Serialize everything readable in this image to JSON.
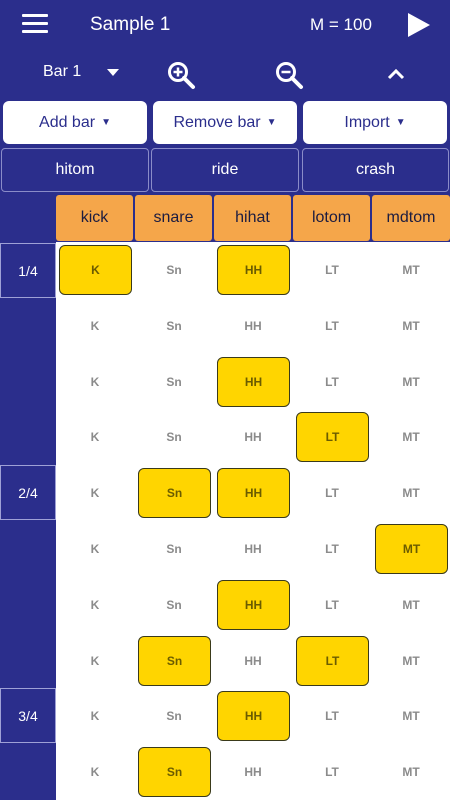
{
  "header": {
    "title": "Sample 1",
    "tempo": "M = 100"
  },
  "toolbar": {
    "bar_label": "Bar 1"
  },
  "actions": {
    "add_bar": "Add bar",
    "remove_bar": "Remove bar",
    "import": "Import",
    "dropdown_glyph": "▼"
  },
  "extra_instruments": [
    "hitom",
    "ride",
    "crash"
  ],
  "columns": [
    "kick",
    "snare",
    "hihat",
    "lotom",
    "mdtom"
  ],
  "cell_labels": [
    "K",
    "Sn",
    "HH",
    "LT",
    "MT"
  ],
  "beat_labels": [
    "1/4",
    "2/4",
    "3/4"
  ],
  "grid": [
    [
      1,
      0,
      1,
      0,
      0
    ],
    [
      0,
      0,
      0,
      0,
      0
    ],
    [
      0,
      0,
      1,
      0,
      0
    ],
    [
      0,
      0,
      0,
      1,
      0
    ],
    [
      0,
      1,
      1,
      0,
      0
    ],
    [
      0,
      0,
      0,
      0,
      1
    ],
    [
      0,
      0,
      1,
      0,
      0
    ],
    [
      0,
      1,
      0,
      1,
      0
    ],
    [
      0,
      0,
      1,
      0,
      0
    ],
    [
      0,
      1,
      0,
      0,
      0
    ]
  ],
  "colors": {
    "background": "#2b2e8c",
    "header_cell": "#f5a64a",
    "active_cell": "#ffd500",
    "grid_bg": "#ffffff"
  }
}
